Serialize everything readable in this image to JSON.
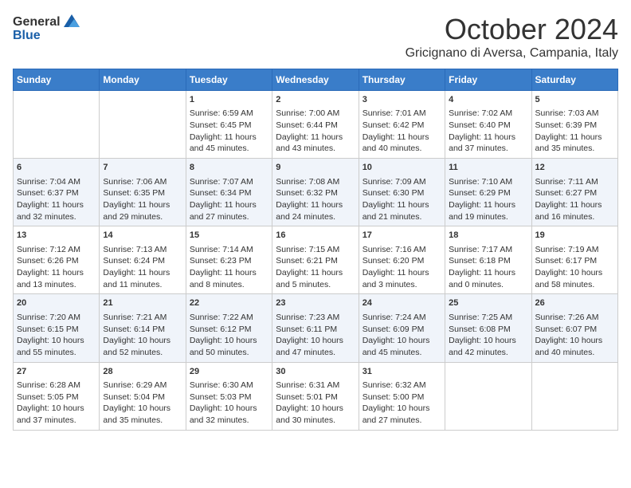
{
  "header": {
    "logo_general": "General",
    "logo_blue": "Blue",
    "month": "October 2024",
    "location": "Gricignano di Aversa, Campania, Italy"
  },
  "days_of_week": [
    "Sunday",
    "Monday",
    "Tuesday",
    "Wednesday",
    "Thursday",
    "Friday",
    "Saturday"
  ],
  "weeks": [
    [
      {
        "day": "",
        "info": ""
      },
      {
        "day": "",
        "info": ""
      },
      {
        "day": "1",
        "info": "Sunrise: 6:59 AM\nSunset: 6:45 PM\nDaylight: 11 hours and 45 minutes."
      },
      {
        "day": "2",
        "info": "Sunrise: 7:00 AM\nSunset: 6:44 PM\nDaylight: 11 hours and 43 minutes."
      },
      {
        "day": "3",
        "info": "Sunrise: 7:01 AM\nSunset: 6:42 PM\nDaylight: 11 hours and 40 minutes."
      },
      {
        "day": "4",
        "info": "Sunrise: 7:02 AM\nSunset: 6:40 PM\nDaylight: 11 hours and 37 minutes."
      },
      {
        "day": "5",
        "info": "Sunrise: 7:03 AM\nSunset: 6:39 PM\nDaylight: 11 hours and 35 minutes."
      }
    ],
    [
      {
        "day": "6",
        "info": "Sunrise: 7:04 AM\nSunset: 6:37 PM\nDaylight: 11 hours and 32 minutes."
      },
      {
        "day": "7",
        "info": "Sunrise: 7:06 AM\nSunset: 6:35 PM\nDaylight: 11 hours and 29 minutes."
      },
      {
        "day": "8",
        "info": "Sunrise: 7:07 AM\nSunset: 6:34 PM\nDaylight: 11 hours and 27 minutes."
      },
      {
        "day": "9",
        "info": "Sunrise: 7:08 AM\nSunset: 6:32 PM\nDaylight: 11 hours and 24 minutes."
      },
      {
        "day": "10",
        "info": "Sunrise: 7:09 AM\nSunset: 6:30 PM\nDaylight: 11 hours and 21 minutes."
      },
      {
        "day": "11",
        "info": "Sunrise: 7:10 AM\nSunset: 6:29 PM\nDaylight: 11 hours and 19 minutes."
      },
      {
        "day": "12",
        "info": "Sunrise: 7:11 AM\nSunset: 6:27 PM\nDaylight: 11 hours and 16 minutes."
      }
    ],
    [
      {
        "day": "13",
        "info": "Sunrise: 7:12 AM\nSunset: 6:26 PM\nDaylight: 11 hours and 13 minutes."
      },
      {
        "day": "14",
        "info": "Sunrise: 7:13 AM\nSunset: 6:24 PM\nDaylight: 11 hours and 11 minutes."
      },
      {
        "day": "15",
        "info": "Sunrise: 7:14 AM\nSunset: 6:23 PM\nDaylight: 11 hours and 8 minutes."
      },
      {
        "day": "16",
        "info": "Sunrise: 7:15 AM\nSunset: 6:21 PM\nDaylight: 11 hours and 5 minutes."
      },
      {
        "day": "17",
        "info": "Sunrise: 7:16 AM\nSunset: 6:20 PM\nDaylight: 11 hours and 3 minutes."
      },
      {
        "day": "18",
        "info": "Sunrise: 7:17 AM\nSunset: 6:18 PM\nDaylight: 11 hours and 0 minutes."
      },
      {
        "day": "19",
        "info": "Sunrise: 7:19 AM\nSunset: 6:17 PM\nDaylight: 10 hours and 58 minutes."
      }
    ],
    [
      {
        "day": "20",
        "info": "Sunrise: 7:20 AM\nSunset: 6:15 PM\nDaylight: 10 hours and 55 minutes."
      },
      {
        "day": "21",
        "info": "Sunrise: 7:21 AM\nSunset: 6:14 PM\nDaylight: 10 hours and 52 minutes."
      },
      {
        "day": "22",
        "info": "Sunrise: 7:22 AM\nSunset: 6:12 PM\nDaylight: 10 hours and 50 minutes."
      },
      {
        "day": "23",
        "info": "Sunrise: 7:23 AM\nSunset: 6:11 PM\nDaylight: 10 hours and 47 minutes."
      },
      {
        "day": "24",
        "info": "Sunrise: 7:24 AM\nSunset: 6:09 PM\nDaylight: 10 hours and 45 minutes."
      },
      {
        "day": "25",
        "info": "Sunrise: 7:25 AM\nSunset: 6:08 PM\nDaylight: 10 hours and 42 minutes."
      },
      {
        "day": "26",
        "info": "Sunrise: 7:26 AM\nSunset: 6:07 PM\nDaylight: 10 hours and 40 minutes."
      }
    ],
    [
      {
        "day": "27",
        "info": "Sunrise: 6:28 AM\nSunset: 5:05 PM\nDaylight: 10 hours and 37 minutes."
      },
      {
        "day": "28",
        "info": "Sunrise: 6:29 AM\nSunset: 5:04 PM\nDaylight: 10 hours and 35 minutes."
      },
      {
        "day": "29",
        "info": "Sunrise: 6:30 AM\nSunset: 5:03 PM\nDaylight: 10 hours and 32 minutes."
      },
      {
        "day": "30",
        "info": "Sunrise: 6:31 AM\nSunset: 5:01 PM\nDaylight: 10 hours and 30 minutes."
      },
      {
        "day": "31",
        "info": "Sunrise: 6:32 AM\nSunset: 5:00 PM\nDaylight: 10 hours and 27 minutes."
      },
      {
        "day": "",
        "info": ""
      },
      {
        "day": "",
        "info": ""
      }
    ]
  ]
}
